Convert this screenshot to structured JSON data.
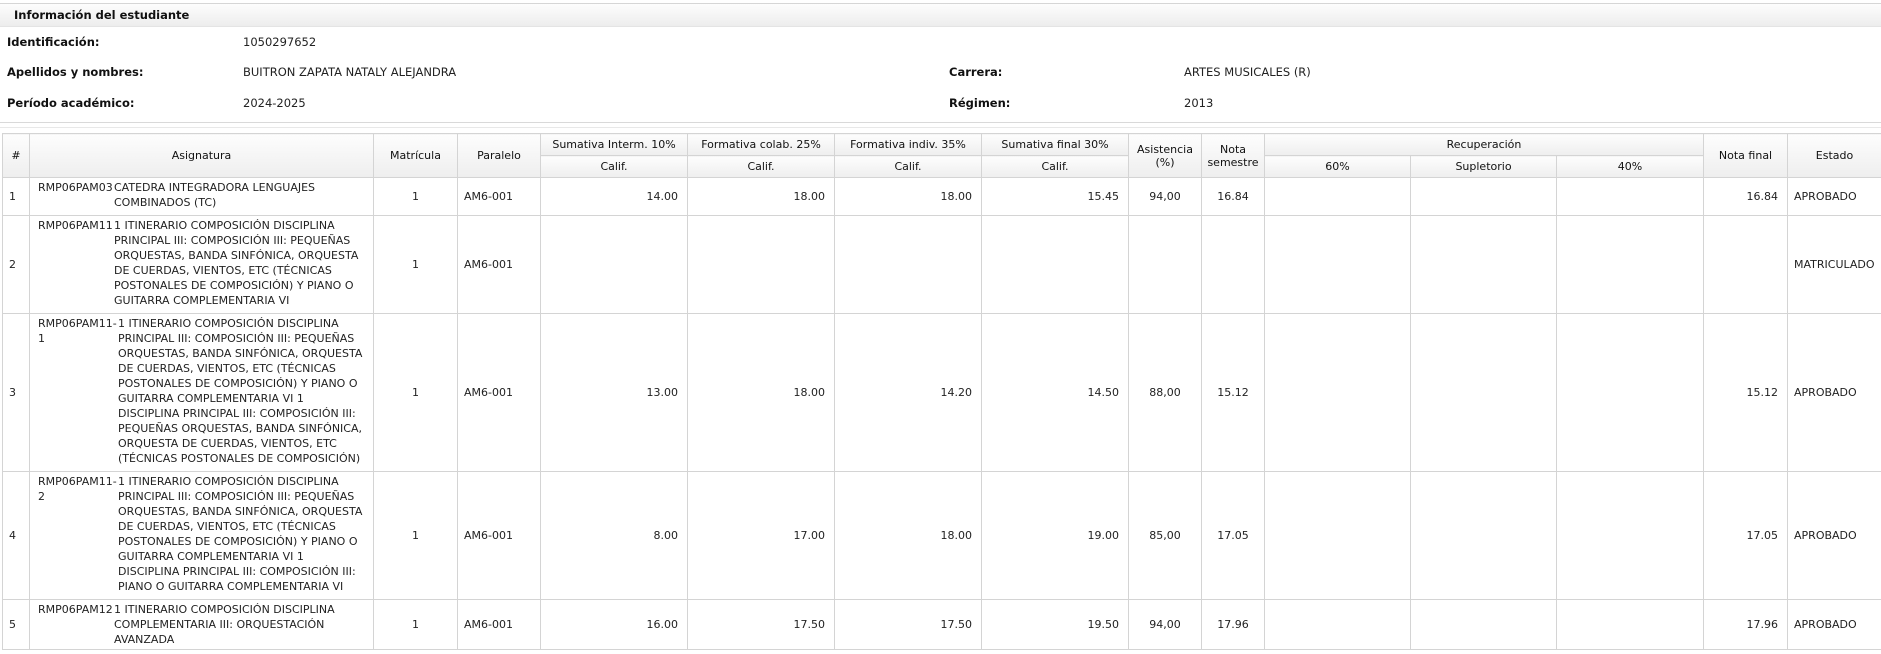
{
  "panel": {
    "title": "Información del estudiante"
  },
  "student": {
    "id_label": "Identificación:",
    "id_value": "1050297652",
    "name_label": "Apellidos y nombres:",
    "name_value": "BUITRON ZAPATA NATALY ALEJANDRA",
    "period_label": "Período académico:",
    "period_value": "2024-2025",
    "career_label": "Carrera:",
    "career_value": "ARTES MUSICALES (R)",
    "regime_label": "Régimen:",
    "regime_value": "2013"
  },
  "table": {
    "headers": {
      "num": "#",
      "subject": "Asignatura",
      "enrollment": "Matrícula",
      "parallel": "Paralelo",
      "sum_interm": "Sumativa Interm. 10%",
      "form_colab": "Formativa colab. 25%",
      "form_indiv": "Formativa indiv. 35%",
      "sum_final": "Sumativa final 30%",
      "attendance": "Asistencia (%)",
      "semester_grade": "Nota semestre",
      "recovery": "Recuperación",
      "final_grade": "Nota final",
      "status": "Estado",
      "calif": "Calif.",
      "rec_60": "60%",
      "rec_supl": "Supletorio",
      "rec_40": "40%"
    },
    "rows": [
      {
        "num": "1",
        "code": "RMP06PAM03",
        "subject": "CATEDRA INTEGRADORA LENGUAJES COMBINADOS (TC)",
        "enrollment": "1",
        "parallel": "AM6-001",
        "s10": "14.00",
        "f25": "18.00",
        "f35": "18.00",
        "s30": "15.45",
        "att": "94,00",
        "sem": "16.84",
        "r60": "",
        "supl": "",
        "r40": "",
        "final": "16.84",
        "status": "APROBADO"
      },
      {
        "num": "2",
        "code": "RMP06PAM11",
        "subject": "1 ITINERARIO COMPOSICIÓN DISCIPLINA PRINCIPAL III: COMPOSICIÓN III: PEQUEÑAS ORQUESTAS, BANDA SINFÓNICA, ORQUESTA DE CUERDAS, VIENTOS, ETC (TÉCNICAS POSTONALES DE COMPOSICIÓN) Y PIANO O GUITARRA COMPLEMENTARIA VI",
        "enrollment": "1",
        "parallel": "AM6-001",
        "s10": "",
        "f25": "",
        "f35": "",
        "s30": "",
        "att": "",
        "sem": "",
        "r60": "",
        "supl": "",
        "r40": "",
        "final": "",
        "status": "MATRICULADO"
      },
      {
        "num": "3",
        "code": "RMP06PAM11-1",
        "subject": "1 ITINERARIO COMPOSICIÓN DISCIPLINA PRINCIPAL III: COMPOSICIÓN III: PEQUEÑAS ORQUESTAS, BANDA SINFÓNICA, ORQUESTA DE CUERDAS, VIENTOS, ETC (TÉCNICAS POSTONALES DE COMPOSICIÓN) Y PIANO O GUITARRA COMPLEMENTARIA VI 1 DISCIPLINA PRINCIPAL III: COMPOSICIÓN III: PEQUEÑAS ORQUESTAS, BANDA SINFÓNICA, ORQUESTA DE CUERDAS, VIENTOS, ETC (TÉCNICAS POSTONALES DE COMPOSICIÓN)",
        "enrollment": "1",
        "parallel": "AM6-001",
        "s10": "13.00",
        "f25": "18.00",
        "f35": "14.20",
        "s30": "14.50",
        "att": "88,00",
        "sem": "15.12",
        "r60": "",
        "supl": "",
        "r40": "",
        "final": "15.12",
        "status": "APROBADO"
      },
      {
        "num": "4",
        "code": "RMP06PAM11-2",
        "subject": "1 ITINERARIO COMPOSICIÓN DISCIPLINA PRINCIPAL III: COMPOSICIÓN III: PEQUEÑAS ORQUESTAS, BANDA SINFÓNICA, ORQUESTA DE CUERDAS, VIENTOS, ETC (TÉCNICAS POSTONALES DE COMPOSICIÓN) Y PIANO O GUITARRA COMPLEMENTARIA VI 1 DISCIPLINA PRINCIPAL III: COMPOSICIÓN III: PIANO O GUITARRA COMPLEMENTARIA VI",
        "enrollment": "1",
        "parallel": "AM6-001",
        "s10": "8.00",
        "f25": "17.00",
        "f35": "18.00",
        "s30": "19.00",
        "att": "85,00",
        "sem": "17.05",
        "r60": "",
        "supl": "",
        "r40": "",
        "final": "17.05",
        "status": "APROBADO"
      },
      {
        "num": "5",
        "code": "RMP06PAM12",
        "subject": "1 ITINERARIO COMPOSICIÓN DISCIPLINA COMPLEMENTARIA III: ORQUESTACIÓN AVANZADA",
        "enrollment": "1",
        "parallel": "AM6-001",
        "s10": "16.00",
        "f25": "17.50",
        "f35": "17.50",
        "s30": "19.50",
        "att": "94,00",
        "sem": "17.96",
        "r60": "",
        "supl": "",
        "r40": "",
        "final": "17.96",
        "status": "APROBADO"
      }
    ]
  }
}
